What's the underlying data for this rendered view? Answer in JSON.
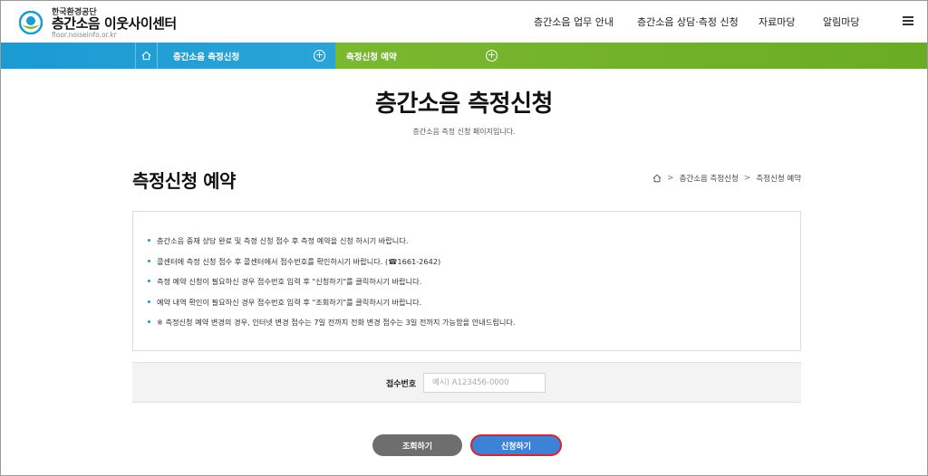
{
  "header": {
    "org": "한국환경공단",
    "site_name": "층간소음 이웃사이센터",
    "url": "floor.noiseinfo.or.kr",
    "nav": [
      "층간소음 업무 안내",
      "층간소음 상담·측정 신청",
      "자료마당",
      "알림마당"
    ]
  },
  "location": {
    "level1": "층간소음 측정신청",
    "level2": "측정신청 예약",
    "colors": {
      "blue": "#1a9bd2",
      "green": "#7ab830"
    }
  },
  "page": {
    "title": "층간소음 측정신청",
    "subtitle": "층간소음 측정 신청 페이지입니다."
  },
  "section": {
    "title": "측정신청 예약",
    "breadcrumb": [
      "층간소음 측정신청",
      "측정신청 예약"
    ]
  },
  "notice": {
    "items": [
      "층간소음 중재 상담 완료 및 측정 신청 접수 후 측정 예약을 신청 하시기 바랍니다.",
      "콜센터에 측정 신청 접수 후 콜센터에서 접수번호를 확인하시기 바랍니다. (☎1661-2642)",
      "측정 예약 신청이 필요하신 경우 접수번호 입력 후 \"신청하기\"를 클릭하시기 바랍니다.",
      "예약 내역 확인이 필요하신 경우 접수번호 입력 후 \"조회하기\"를 클릭하시기 바랍니다.",
      "※ 측정신청 예약 변경의 경우, 인터넷 변경 접수는 7일 전까지 전화 변경 접수는 3일 전까지 가능함을 안내드립니다."
    ]
  },
  "form": {
    "label": "접수번호",
    "value": "",
    "placeholder": "예시) A123456-0000"
  },
  "buttons": {
    "inquiry": "조회하기",
    "apply": "신청하기",
    "apply_highlight": "#e0202e"
  }
}
